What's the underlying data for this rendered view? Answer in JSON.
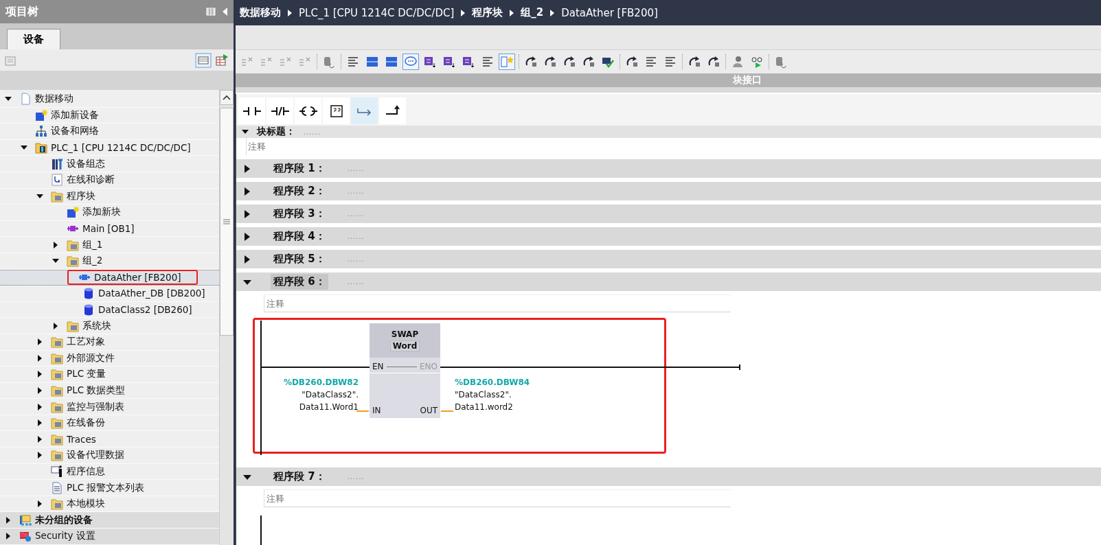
{
  "project_tree": {
    "title": "项目树",
    "tabs": [
      {
        "label": "设备",
        "selected": true
      }
    ],
    "items": [
      {
        "label": "数据移动",
        "kind": "project",
        "expanded": true,
        "selected": false,
        "children": [
          {
            "label": "添加新设备",
            "kind": "add",
            "selected": false
          },
          {
            "label": "设备和网络",
            "kind": "network",
            "selected": false
          },
          {
            "label": "PLC_1 [CPU 1214C DC/DC/DC]",
            "kind": "plc",
            "expanded": true,
            "selected": false,
            "children": [
              {
                "label": "设备组态",
                "kind": "config",
                "selected": false
              },
              {
                "label": "在线和诊断",
                "kind": "diag",
                "selected": false
              },
              {
                "label": "程序块",
                "kind": "folder",
                "expanded": true,
                "selected": false,
                "children": [
                  {
                    "label": "添加新块",
                    "kind": "add",
                    "selected": false
                  },
                  {
                    "label": "Main [OB1]",
                    "kind": "block",
                    "color": "#9b30d0",
                    "selected": false
                  },
                  {
                    "label": "组_1",
                    "kind": "folder",
                    "expanded": false,
                    "selected": false
                  },
                  {
                    "label": "组_2",
                    "kind": "folder",
                    "expanded": true,
                    "selected": false,
                    "children": [
                      {
                        "label": "DataAther [FB200]",
                        "kind": "block",
                        "color": "#2f6fe0",
                        "selected": true,
                        "highlighted": true
                      },
                      {
                        "label": "DataAther_DB [DB200]",
                        "kind": "db",
                        "selected": false
                      },
                      {
                        "label": "DataClass2 [DB260]",
                        "kind": "db",
                        "selected": false
                      }
                    ]
                  },
                  {
                    "label": "系统块",
                    "kind": "folder",
                    "expanded": false,
                    "selected": false
                  }
                ]
              },
              {
                "label": "工艺对象",
                "kind": "folder",
                "expanded": false,
                "selected": false
              },
              {
                "label": "外部源文件",
                "kind": "folder",
                "expanded": false,
                "selected": false
              },
              {
                "label": "PLC 变量",
                "kind": "folder",
                "expanded": false,
                "selected": false
              },
              {
                "label": "PLC 数据类型",
                "kind": "folder",
                "expanded": false,
                "selected": false
              },
              {
                "label": "监控与强制表",
                "kind": "folder",
                "expanded": false,
                "selected": false
              },
              {
                "label": "在线备份",
                "kind": "folder",
                "expanded": false,
                "selected": false
              },
              {
                "label": "Traces",
                "kind": "folder",
                "expanded": false,
                "selected": false
              },
              {
                "label": "设备代理数据",
                "kind": "folder",
                "expanded": false,
                "selected": false
              },
              {
                "label": "程序信息",
                "kind": "info",
                "selected": false
              },
              {
                "label": "PLC 报警文本列表",
                "kind": "list",
                "selected": false
              },
              {
                "label": "本地模块",
                "kind": "folder",
                "expanded": false,
                "selected": false
              }
            ]
          }
        ]
      },
      {
        "label": "未分组的设备",
        "kind": "group",
        "bold": true,
        "expanded": false,
        "selected": false
      },
      {
        "label": "Security 设置",
        "kind": "security",
        "expanded": false,
        "selected": false
      }
    ]
  },
  "breadcrumb": [
    "数据移动",
    "PLC_1 [CPU 1214C DC/DC/DC]",
    "程序块",
    "组_2",
    "DataAther [FB200]"
  ],
  "interface_bar": {
    "label": "块接口"
  },
  "block_title": {
    "label": "块标题：",
    "dots": "......",
    "comment": "注释"
  },
  "networks": [
    {
      "title": "程序段 1：",
      "dots": "......",
      "expanded": false,
      "selected": false
    },
    {
      "title": "程序段 2：",
      "dots": "......",
      "expanded": false,
      "selected": false
    },
    {
      "title": "程序段 3：",
      "dots": "......",
      "expanded": false,
      "selected": false
    },
    {
      "title": "程序段 4：",
      "dots": "......",
      "expanded": false,
      "selected": false
    },
    {
      "title": "程序段 5：",
      "dots": "......",
      "expanded": false,
      "selected": false
    },
    {
      "title": "程序段 6：",
      "dots": "......",
      "expanded": true,
      "selected": true,
      "comment": "注释",
      "highlighted": true,
      "ladder": {
        "box_title": "SWAP",
        "box_type": "Word",
        "en": "EN",
        "eno": "ENO",
        "eno_disabled": true,
        "in_pin": "IN",
        "out_pin": "OUT",
        "in_address": "%DB260.DBW82",
        "in_symbol": [
          "\"DataClass2\".",
          "Data11.Word1"
        ],
        "out_address": "%DB260.DBW84",
        "out_symbol": [
          "\"DataClass2\".",
          "Data11.word2"
        ]
      }
    },
    {
      "title": "程序段 7：",
      "dots": "......",
      "expanded": true,
      "selected": false,
      "comment": "注释"
    }
  ]
}
